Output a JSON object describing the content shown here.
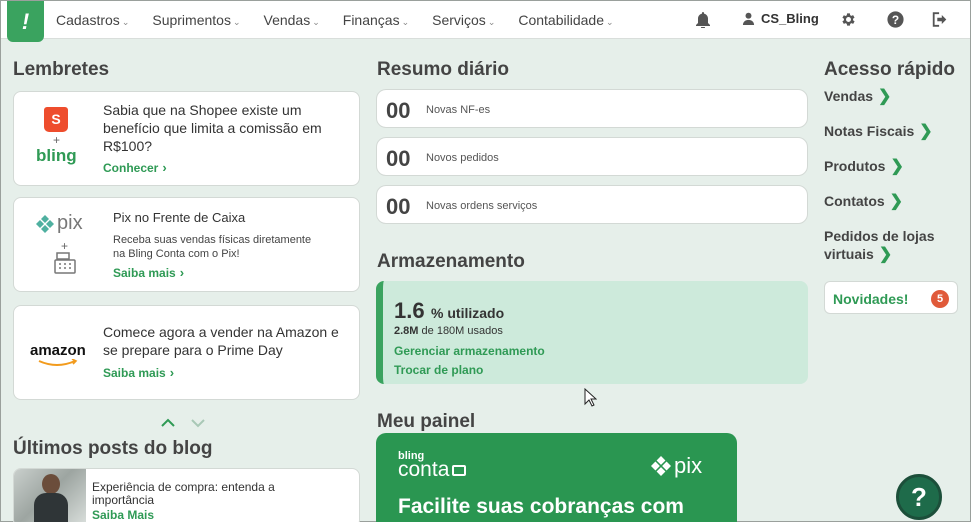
{
  "nav": {
    "logo": "!",
    "menu": [
      {
        "label": "Cadastros"
      },
      {
        "label": "Suprimentos"
      },
      {
        "label": "Vendas"
      },
      {
        "label": "Finanças"
      },
      {
        "label": "Serviços"
      },
      {
        "label": "Contabilidade"
      }
    ],
    "user": "CS_Bling"
  },
  "lembretes": {
    "title": "Lembretes",
    "cards": [
      {
        "text_l1": "Sabia que na Shopee existe um",
        "text_l2": "benefício que limita a comissão em",
        "text_l3": "R$100?",
        "link": "Conhecer",
        "brand": "bling",
        "plus": "+",
        "shopee": "S"
      },
      {
        "title": "Pix no Frente de Caixa",
        "desc_l1": "Receba suas vendas físicas diretamente",
        "desc_l2": "na Bling Conta com o Pix!",
        "link": "Saiba mais",
        "brand": "pix",
        "plus": "+"
      },
      {
        "text_l1": "Comece agora a vender na Amazon e",
        "text_l2": "se prepare para o Prime Day",
        "link": "Saiba mais",
        "brand": "amazon"
      }
    ]
  },
  "blog": {
    "title": "Últimos posts do blog",
    "post_l1": "Experiência de compra: entenda a",
    "post_l2": "importância",
    "link": "Saiba Mais"
  },
  "resumo": {
    "title": "Resumo diário",
    "items": [
      {
        "count": "00",
        "label": "Novas NF-es"
      },
      {
        "count": "00",
        "label": "Novos pedidos"
      },
      {
        "count": "00",
        "label": "Novas ordens serviços"
      }
    ]
  },
  "armazenamento": {
    "title": "Armazenamento",
    "percent": "1.6",
    "percent_suffix": "% utilizado",
    "used": "2.8M",
    "used_suffix": "de 180M usados",
    "link_manage": "Gerenciar armazenamento",
    "link_plan": "Trocar de plano"
  },
  "painel": {
    "title": "Meu painel",
    "banner_brand_top": "bling",
    "banner_brand": "conta",
    "banner_pix": "pix",
    "banner_headline": "Facilite suas cobranças com"
  },
  "acesso": {
    "title": "Acesso rápido",
    "links": [
      "Vendas",
      "Notas Fiscais",
      "Produtos",
      "Contatos"
    ],
    "pedidos_l1": "Pedidos de lojas",
    "pedidos_l2": "virtuais",
    "novidades": "Novidades!",
    "novidades_count": "5"
  },
  "help": "?",
  "colors": {
    "brand_green": "#3aa35f",
    "link_green": "#2f9a55",
    "badge": "#e05a3a"
  }
}
